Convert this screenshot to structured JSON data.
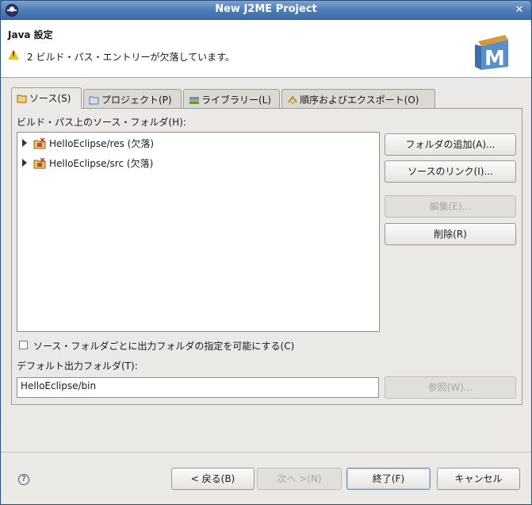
{
  "window": {
    "title": "New J2ME Project"
  },
  "header": {
    "title": "Java 設定",
    "message": "2 ビルド・パス・エントリーが欠落しています。"
  },
  "tabs": [
    {
      "label": "ソース(S)",
      "icon": "source-folder-icon",
      "active": true
    },
    {
      "label": "プロジェクト(P)",
      "icon": "project-folder-icon",
      "active": false
    },
    {
      "label": "ライブラリー(L)",
      "icon": "library-icon",
      "active": false
    },
    {
      "label": "順序およびエクスポート(O)",
      "icon": "order-export-icon",
      "active": false
    }
  ],
  "source_panel": {
    "folders_label": "ビルド・パス上のソース・フォルダ(H):",
    "folders": [
      {
        "label": "HelloEclipse/res (欠落)"
      },
      {
        "label": "HelloEclipse/src (欠落)"
      }
    ],
    "buttons": {
      "add_folder": "フォルダの追加(A)...",
      "link_source": "ソースのリンク(I)...",
      "edit": "編集(E)...",
      "remove": "削除(R)"
    },
    "allow_output_folders_label": "ソース・フォルダごとに出力フォルダの指定を可能にする(C)",
    "default_output_label": "デフォルト出力フォルダ(T):",
    "default_output_value": "HelloEclipse/bin",
    "browse_button": "参照(W)..."
  },
  "footer": {
    "back": "< 戻る(B)",
    "next": "次へ >(N)",
    "finish": "終了(F)",
    "cancel": "キャンセル"
  }
}
